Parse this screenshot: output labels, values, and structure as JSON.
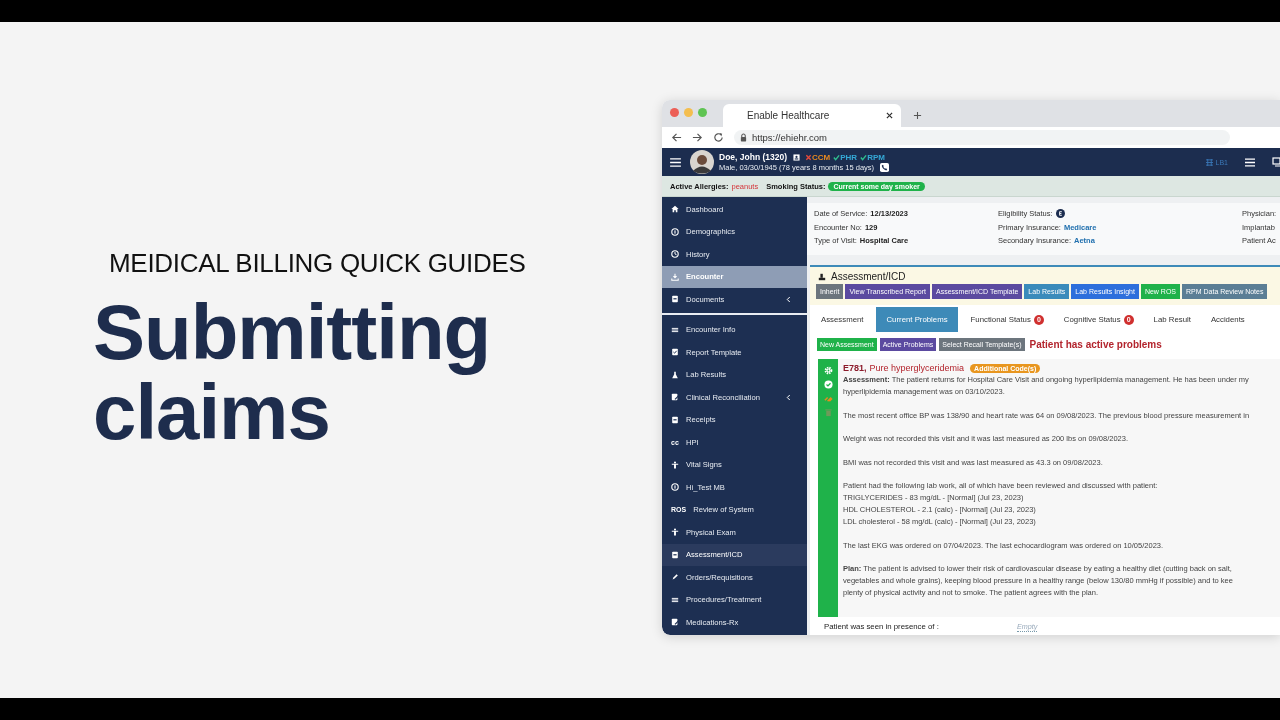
{
  "slide": {
    "subtitle": "MEIDICAL BILLING QUICK GUIDES",
    "title": "Submitting claims"
  },
  "browser": {
    "tab_title": "Enable Healthcare",
    "url": "https://ehiehr.com"
  },
  "patient": {
    "name": "Doe, John (1320)",
    "details": "Male, 03/30/1945 (78 years 8 months 15 days)",
    "header_right": "LB1",
    "programs": [
      {
        "label": "CCM",
        "enrolled": false
      },
      {
        "label": "PHR",
        "enrolled": true
      },
      {
        "label": "RPM",
        "enrolled": true
      }
    ]
  },
  "alerts": {
    "allergies_label": "Active Allergies:",
    "allergies": "peanuts",
    "smoking_label": "Smoking Status:",
    "smoking": "Current some day smoker"
  },
  "sidebar": {
    "main_items": [
      {
        "label": "Dashboard",
        "selected": false,
        "submenu": false
      },
      {
        "label": "Demographics",
        "selected": false,
        "submenu": false
      },
      {
        "label": "History",
        "selected": false,
        "submenu": false
      },
      {
        "label": "Encounter",
        "selected": true,
        "submenu": false
      },
      {
        "label": "Documents",
        "selected": false,
        "submenu": true
      }
    ],
    "encounter_items": [
      {
        "label": "Encounter Info",
        "selected": false,
        "submenu": false
      },
      {
        "label": "Report Template",
        "selected": false,
        "submenu": false
      },
      {
        "label": "Lab Results",
        "selected": false,
        "submenu": false
      },
      {
        "label": "Clinical Reconciliation",
        "selected": false,
        "submenu": true
      },
      {
        "label": "Receipts",
        "selected": false,
        "submenu": false
      },
      {
        "label": "HPI",
        "selected": false,
        "submenu": false,
        "icon_text": "cc"
      },
      {
        "label": "Vital Signs",
        "selected": false,
        "submenu": false
      },
      {
        "label": "Hi_Test MB",
        "selected": false,
        "submenu": false
      },
      {
        "label": "Review of System",
        "selected": false,
        "submenu": false,
        "icon_text": "ROS"
      },
      {
        "label": "Physical Exam",
        "selected": false,
        "submenu": false
      },
      {
        "label": "Assessment/ICD",
        "selected": true,
        "submenu": false
      },
      {
        "label": "Orders/Requisitions",
        "selected": false,
        "submenu": false
      },
      {
        "label": "Procedures/Treatment",
        "selected": false,
        "submenu": false
      },
      {
        "label": "Medications-Rx",
        "selected": false,
        "submenu": false
      }
    ]
  },
  "encounter_info": {
    "columns": [
      [
        {
          "label": "Date of Service:",
          "value": "12/13/2023",
          "kind": "bold"
        },
        {
          "label": "Encounter No:",
          "value": "129",
          "kind": "bold"
        },
        {
          "label": "Type of Visit:",
          "value": "Hospital Care",
          "kind": "bold"
        }
      ],
      [
        {
          "label": "Eligibility Status:",
          "kind": "status"
        },
        {
          "label": "Primary Insurance:",
          "value": "Medicare",
          "kind": "link"
        },
        {
          "label": "Secondary Insurance:",
          "value": "Aetna",
          "kind": "link"
        }
      ],
      [
        {
          "label": "Physician:",
          "kind": "label"
        },
        {
          "label": "Implantab",
          "kind": "label"
        },
        {
          "label": "Patient Ac",
          "kind": "label"
        }
      ]
    ]
  },
  "assessment": {
    "title": "Assessment/ICD",
    "actions": [
      {
        "label": "Inherit",
        "color": "#6c757d"
      },
      {
        "label": "View Transcribed Report",
        "color": "#5b4aa0"
      },
      {
        "label": "Assessment/ICD Template",
        "color": "#5b4aa0"
      },
      {
        "label": "Lab Results",
        "color": "#3a8bbb"
      },
      {
        "label": "Lab Results Insight",
        "color": "#2d6fdc"
      },
      {
        "label": "New ROS",
        "color": "#1fb24a"
      },
      {
        "label": "RPM Data Review Notes",
        "color": "#5b7e95"
      }
    ],
    "tabs": [
      {
        "label": "Assessment",
        "selected": false
      },
      {
        "label": "Current Problems",
        "selected": true
      },
      {
        "label": "Functional Status",
        "selected": false,
        "badge": "0"
      },
      {
        "label": "Cognitive Status",
        "selected": false,
        "badge": "0"
      },
      {
        "label": "Lab Result",
        "selected": false
      },
      {
        "label": "Accidents",
        "selected": false
      }
    ],
    "tools": [
      {
        "label": "New Assessment",
        "color": "#1fb24a"
      },
      {
        "label": "Active Problems",
        "color": "#5b4aa0"
      },
      {
        "label": "Select Recall Template(s)",
        "color": "#6c757d"
      }
    ],
    "alert": "Patient has active problems",
    "problem": {
      "code": "E781,",
      "name": "Pure hyperglyceridemia",
      "badge": "Additional Code(s)",
      "paragraphs": [
        "**Assessment:** The patient returns for Hospital Care Visit and ongoing hyperlipidemia management. He has been under my\nhyperlipidemia management was on 03/10/2023.",
        "The most recent office BP was 138/90 and heart rate was 64 on 09/08/2023. The previous blood pressure measurement in",
        "Weight was not recorded this visit and it was last measured as 200 lbs on 09/08/2023.",
        "BMI was not recorded this visit and was last measured as 43.3 on 09/08/2023.",
        "Patient had the following lab work, all of which have been reviewed and discussed with patient:\nTRIGLYCERIDES - 83 mg/dL - [Normal] (Jul 23, 2023)\nHDL CHOLESTEROL - 2.1 (calc) - [Normal] (Jul 23, 2023)\nLDL cholesterol - 58 mg/dL (calc) - [Normal] (Jul 23, 2023)",
        "The last EKG was ordered on 07/04/2023. The last echocardiogram was ordered on 10/05/2023.",
        "**Plan:** The patient is advised to lower their risk of cardiovascular disease by eating a healthy diet (cutting back on salt,\nvegetables and whole grains), keeping blood pressure in a healthy range (below 130/80 mmHg if possible) and to kee\nplenty of physical activity and not to smoke. The patient agrees with the plan."
      ]
    },
    "presence": {
      "label": "Patient was seen in presence of :",
      "value": "Empty"
    }
  }
}
